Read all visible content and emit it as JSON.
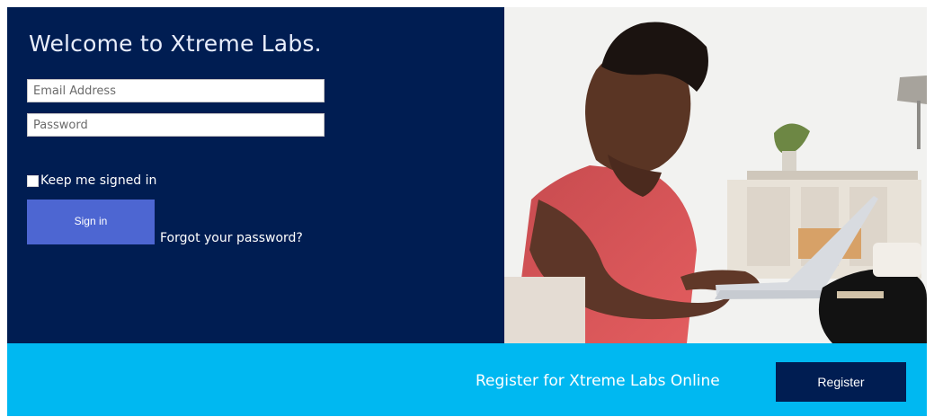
{
  "page": {
    "title": "Welcome to Xtreme Labs.",
    "email_placeholder": "Email Address",
    "password_placeholder": "Password",
    "remember_label": "Keep me signed in",
    "signin_label": "Sign in",
    "forgot_label": "Forgot your password?",
    "register_text": "Register for Xtreme Labs Online",
    "register_button": "Register"
  },
  "colors": {
    "panel": "#001d52",
    "accent": "#00b8f1",
    "signin": "#4d66d2"
  },
  "icons": {
    "checkbox": "checkbox-icon"
  }
}
